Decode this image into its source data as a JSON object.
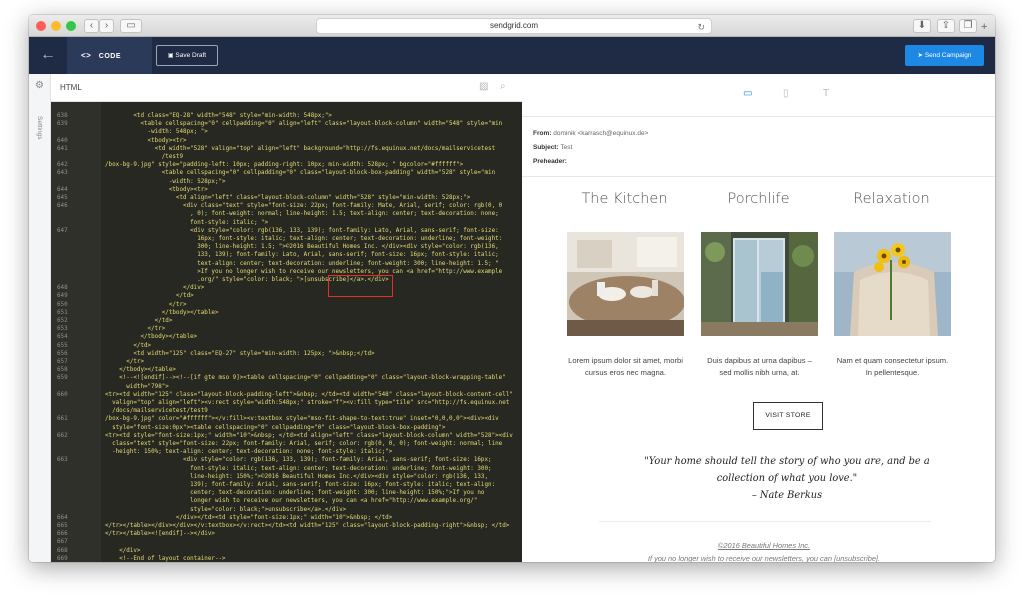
{
  "browser": {
    "url": "sendgrid.com"
  },
  "toolbar": {
    "code_tab": "CODE",
    "save_draft": "Save Draft",
    "send_campaign": "Send Campaign"
  },
  "sidebar": {
    "settings_label": "Settings"
  },
  "editor": {
    "title": "HTML",
    "lines": [
      {
        "n": "638",
        "t": "        <td class=\"EQ-28\" width=\"548\" style=\"min-width: 548px;\">"
      },
      {
        "n": "639",
        "t": "          <table cellspacing=\"0\" cellpadding=\"0\" align=\"left\" class=\"layout-block-column\" width=\"548\" style=\"min"
      },
      {
        "n": "",
        "t": "            -width: 548px; \">"
      },
      {
        "n": "640",
        "t": "            <tbody><tr>"
      },
      {
        "n": "641",
        "t": "              <td width=\"528\" valign=\"top\" align=\"left\" background=\"http://fs.equinux.net/docs/mailservicetest"
      },
      {
        "n": "",
        "t": "                /test9"
      },
      {
        "n": "642",
        "t": "/box-bg-9.jpg\" style=\"padding-left: 10px; padding-right: 10px; min-width: 528px; \" bgcolor=\"#ffffff\">"
      },
      {
        "n": "643",
        "t": "                <table cellspacing=\"0\" cellpadding=\"0\" class=\"layout-block-box-padding\" width=\"528\" style=\"min"
      },
      {
        "n": "",
        "t": "                  -width: 528px;\">"
      },
      {
        "n": "644",
        "t": "                  <tbody><tr>"
      },
      {
        "n": "645",
        "t": "                    <td align=\"left\" class=\"layout-block-column\" width=\"528\" style=\"min-width: 528px;\">"
      },
      {
        "n": "646",
        "t": "                      <div class=\"text\" style=\"font-size: 22px; font-family: Mate, Arial, serif; color: rgb(0, 0"
      },
      {
        "n": "",
        "t": "                        , 0); font-weight: normal; line-height: 1.5; text-align: center; text-decoration: none;"
      },
      {
        "n": "",
        "t": "                        font-style: italic; \">"
      },
      {
        "n": "647",
        "t": "                        <div style=\"color: rgb(136, 133, 139); font-family: Lato, Arial, sans-serif; font-size:"
      },
      {
        "n": "",
        "t": "                          16px; font-style: italic; text-align: center; text-decoration: underline; font-weight:"
      },
      {
        "n": "",
        "t": "                          300; line-height: 1.5; \">©2016 Beautiful Homes Inc. </div><div style=\"color: rgb(136,"
      },
      {
        "n": "",
        "t": "                          133, 139); font-family: Lato, Arial, sans-serif; font-size: 16px; font-style: italic;"
      },
      {
        "n": "",
        "t": "                          text-align: center; text-decoration: underline; font-weight: 300; line-height: 1.5; \""
      },
      {
        "n": "",
        "t": "                          >If you no longer wish to receive our newsletters, you can <a href=\"http://www.example"
      },
      {
        "n": "",
        "t": "                          .org/\" style=\"color: black; \">[unsubscribe]</a>.</div>"
      },
      {
        "n": "648",
        "t": "                      </div>"
      },
      {
        "n": "649",
        "t": "                    </td>"
      },
      {
        "n": "650",
        "t": "                  </tr>"
      },
      {
        "n": "651",
        "t": "                </tbody></table>"
      },
      {
        "n": "652",
        "t": "              </td>"
      },
      {
        "n": "653",
        "t": "            </tr>"
      },
      {
        "n": "654",
        "t": "          </tbody></table>"
      },
      {
        "n": "655",
        "t": "        </td>"
      },
      {
        "n": "656",
        "t": "        <td width=\"125\" class=\"EQ-27\" style=\"min-width: 125px; \">&nbsp;</td>"
      },
      {
        "n": "657",
        "t": "      </tr>"
      },
      {
        "n": "658",
        "t": "    </tbody></table>"
      },
      {
        "n": "659",
        "t": "    <!--<![endif]--><!--[if gte mso 9]><table cellspacing=\"0\" cellpadding=\"0\" class=\"layout-block-wrapping-table\""
      },
      {
        "n": "",
        "t": "      width=\"798\">"
      },
      {
        "n": "660",
        "t": "<tr><td width=\"125\" class=\"layout-block-padding-left\">&nbsp; </td><td width=\"548\" class=\"layout-block-content-cell\""
      },
      {
        "n": "",
        "t": "  valign=\"top\" align=\"left\"><v:rect style=\"width:548px;\" stroke=\"f\"><v:fill type=\"tile\" src=\"http://fs.equinux.net"
      },
      {
        "n": "",
        "t": "  /docs/mailservicetest/test9"
      },
      {
        "n": "661",
        "t": "/box-bg-9.jpg\" color=\"#ffffff\"></v:fill><v:textbox style=\"mso-fit-shape-to-text:true\" inset=\"0,0,0,0\"><div><div"
      },
      {
        "n": "",
        "t": "  style=\"font-size:0px\"><table cellspacing=\"0\" cellpadding=\"0\" class=\"layout-block-box-padding\">"
      },
      {
        "n": "662",
        "t": "<tr><td style=\"font-size:1px;\" width=\"10\">&nbsp; </td><td align=\"left\" class=\"layout-block-column\" width=\"528\"><div"
      },
      {
        "n": "",
        "t": "  class=\"text\" style=\"font-size: 22px; font-family: Arial, serif; color: rgb(0, 0, 0); font-weight: normal; line"
      },
      {
        "n": "",
        "t": "  -height: 150%; text-align: center; text-decoration: none; font-style: italic;\">"
      },
      {
        "n": "663",
        "t": "                      <div style=\"color: rgb(136, 133, 139); font-family: Arial, sans-serif; font-size: 16px;"
      },
      {
        "n": "",
        "t": "                        font-style: italic; text-align: center; text-decoration: underline; font-weight: 300;"
      },
      {
        "n": "",
        "t": "                        line-height: 150%;\">©2016 Beautiful Homes Inc.</div><div style=\"color: rgb(136, 133,"
      },
      {
        "n": "",
        "t": "                        139); font-family: Arial, sans-serif; font-size: 16px; font-style: italic; text-align:"
      },
      {
        "n": "",
        "t": "                        center; text-decoration: underline; font-weight: 300; line-height: 150%;\">If you no"
      },
      {
        "n": "",
        "t": "                        longer wish to receive our newsletters, you can <a href=\"http://www.example.org/\""
      },
      {
        "n": "",
        "t": "                        style=\"color: black;\">unsubscribe</a>.</div>"
      },
      {
        "n": "664",
        "t": "                    </div></td><td style=\"font-size:1px;\" width=\"10\">&nbsp; </td>"
      },
      {
        "n": "665",
        "t": "</tr></table></div></div></v:textbox></v:rect></td><td width=\"125\" class=\"layout-block-padding-right\">&nbsp; </td>"
      },
      {
        "n": "666",
        "t": "</tr></table><![endif]--></div>"
      },
      {
        "n": "667",
        "t": ""
      },
      {
        "n": "668",
        "t": "    </div>"
      },
      {
        "n": "669",
        "t": "    <!--End of layout container-->"
      }
    ]
  },
  "preview": {
    "from_label": "From:",
    "from_value": "dominik <karrasch@equinux.de>",
    "subject_label": "Subject:",
    "subject_value": "Test",
    "preheader_label": "Preheader:",
    "columns": [
      {
        "title": "The Kitchen",
        "caption": "Lorem ipsum dolor sit amet, morbi cursus eros nec magna."
      },
      {
        "title": "Porchlife",
        "caption": "Duis dapibus at urna dapibus – sed mollis nibh urna, at."
      },
      {
        "title": "Relaxation",
        "caption": "Nam et quam consectetur ipsum. In pellentesque."
      }
    ],
    "visit_store": "VISIT STORE",
    "quote_line1": "\"Your home should tell the story of who you are, and be a",
    "quote_line2": "collection of what you love.\"",
    "quote_author": "– Nate Berkus",
    "footer_copyright": "©2016 Beautiful Homes Inc.",
    "footer_text": "If you no longer wish to receive our newsletters, you can ",
    "footer_unsubscribe": "[unsubscribe]",
    "footer_period": "."
  },
  "colors": {
    "navy": "#1f2a44",
    "accent": "#1e88e5",
    "highlight": "#e0322b"
  }
}
